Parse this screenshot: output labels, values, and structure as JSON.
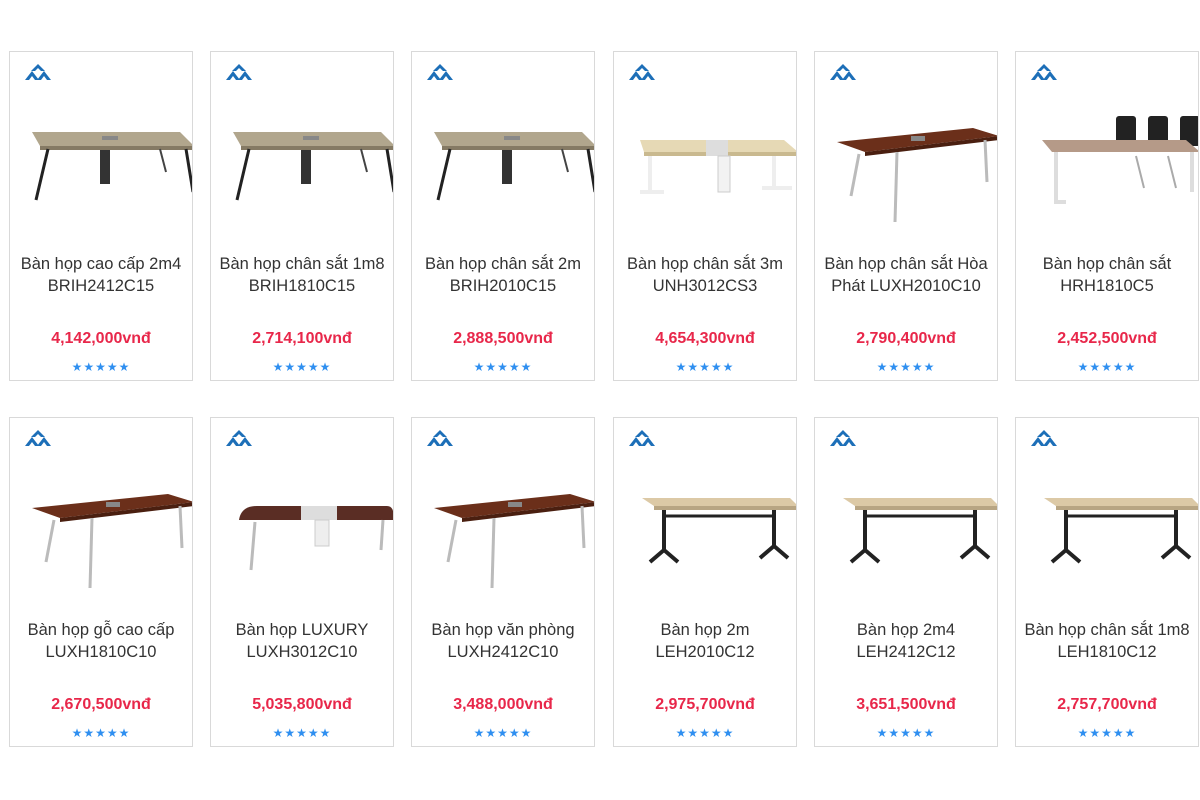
{
  "products": [
    {
      "name": "Bàn họp cao cấp 2m4 BRIH2412C15",
      "price": "4,142,000vnđ",
      "rating": "★★★★★",
      "image": "meeting-table-beige-black-legs"
    },
    {
      "name": "Bàn họp chân sắt 1m8 BRIH1810C15",
      "price": "2,714,100vnđ",
      "rating": "★★★★★",
      "image": "meeting-table-beige-black-legs"
    },
    {
      "name": "Bàn họp chân sắt 2m BRIH2010C15",
      "price": "2,888,500vnđ",
      "rating": "★★★★★",
      "image": "meeting-table-beige-black-legs"
    },
    {
      "name": "Bàn họp chân sắt 3m UNH3012CS3",
      "price": "4,654,300vnđ",
      "rating": "★★★★★",
      "image": "meeting-table-cream-white-legs"
    },
    {
      "name": "Bàn họp chân sắt Hòa Phát LUXH2010C10",
      "price": "2,790,400vnđ",
      "rating": "★★★★★",
      "image": "meeting-table-walnut"
    },
    {
      "name": "Bàn họp chân sắt HRH1810C5",
      "price": "2,452,500vnđ",
      "rating": "★★★★★",
      "image": "meeting-table-with-chairs"
    },
    {
      "name": "Bàn họp gỗ cao cấp LUXH1810C10",
      "price": "2,670,500vnđ",
      "rating": "★★★★★",
      "image": "meeting-table-walnut"
    },
    {
      "name": "Bàn họp LUXURY LUXH3012C10",
      "price": "5,035,800vnđ",
      "rating": "★★★★★",
      "image": "meeting-table-dark-rounded"
    },
    {
      "name": "Bàn họp văn phòng LUXH2412C10",
      "price": "3,488,000vnđ",
      "rating": "★★★★★",
      "image": "meeting-table-walnut"
    },
    {
      "name": "Bàn họp 2m LEH2010C12",
      "price": "2,975,700vnđ",
      "rating": "★★★★★",
      "image": "meeting-table-light-black-frame"
    },
    {
      "name": "Bàn họp 2m4 LEH2412C12",
      "price": "3,651,500vnđ",
      "rating": "★★★★★",
      "image": "meeting-table-light-black-frame"
    },
    {
      "name": "Bàn họp chân sắt 1m8 LEH1810C12",
      "price": "2,757,700vnđ",
      "rating": "★★★★★",
      "image": "meeting-table-light-black-frame"
    }
  ],
  "brand_icon": "hoa-phat-logo-icon",
  "colors": {
    "price": "#e8274a",
    "stars": "#2f8ff0",
    "logo": "#1d6fb8",
    "border": "#d9d9d9"
  }
}
